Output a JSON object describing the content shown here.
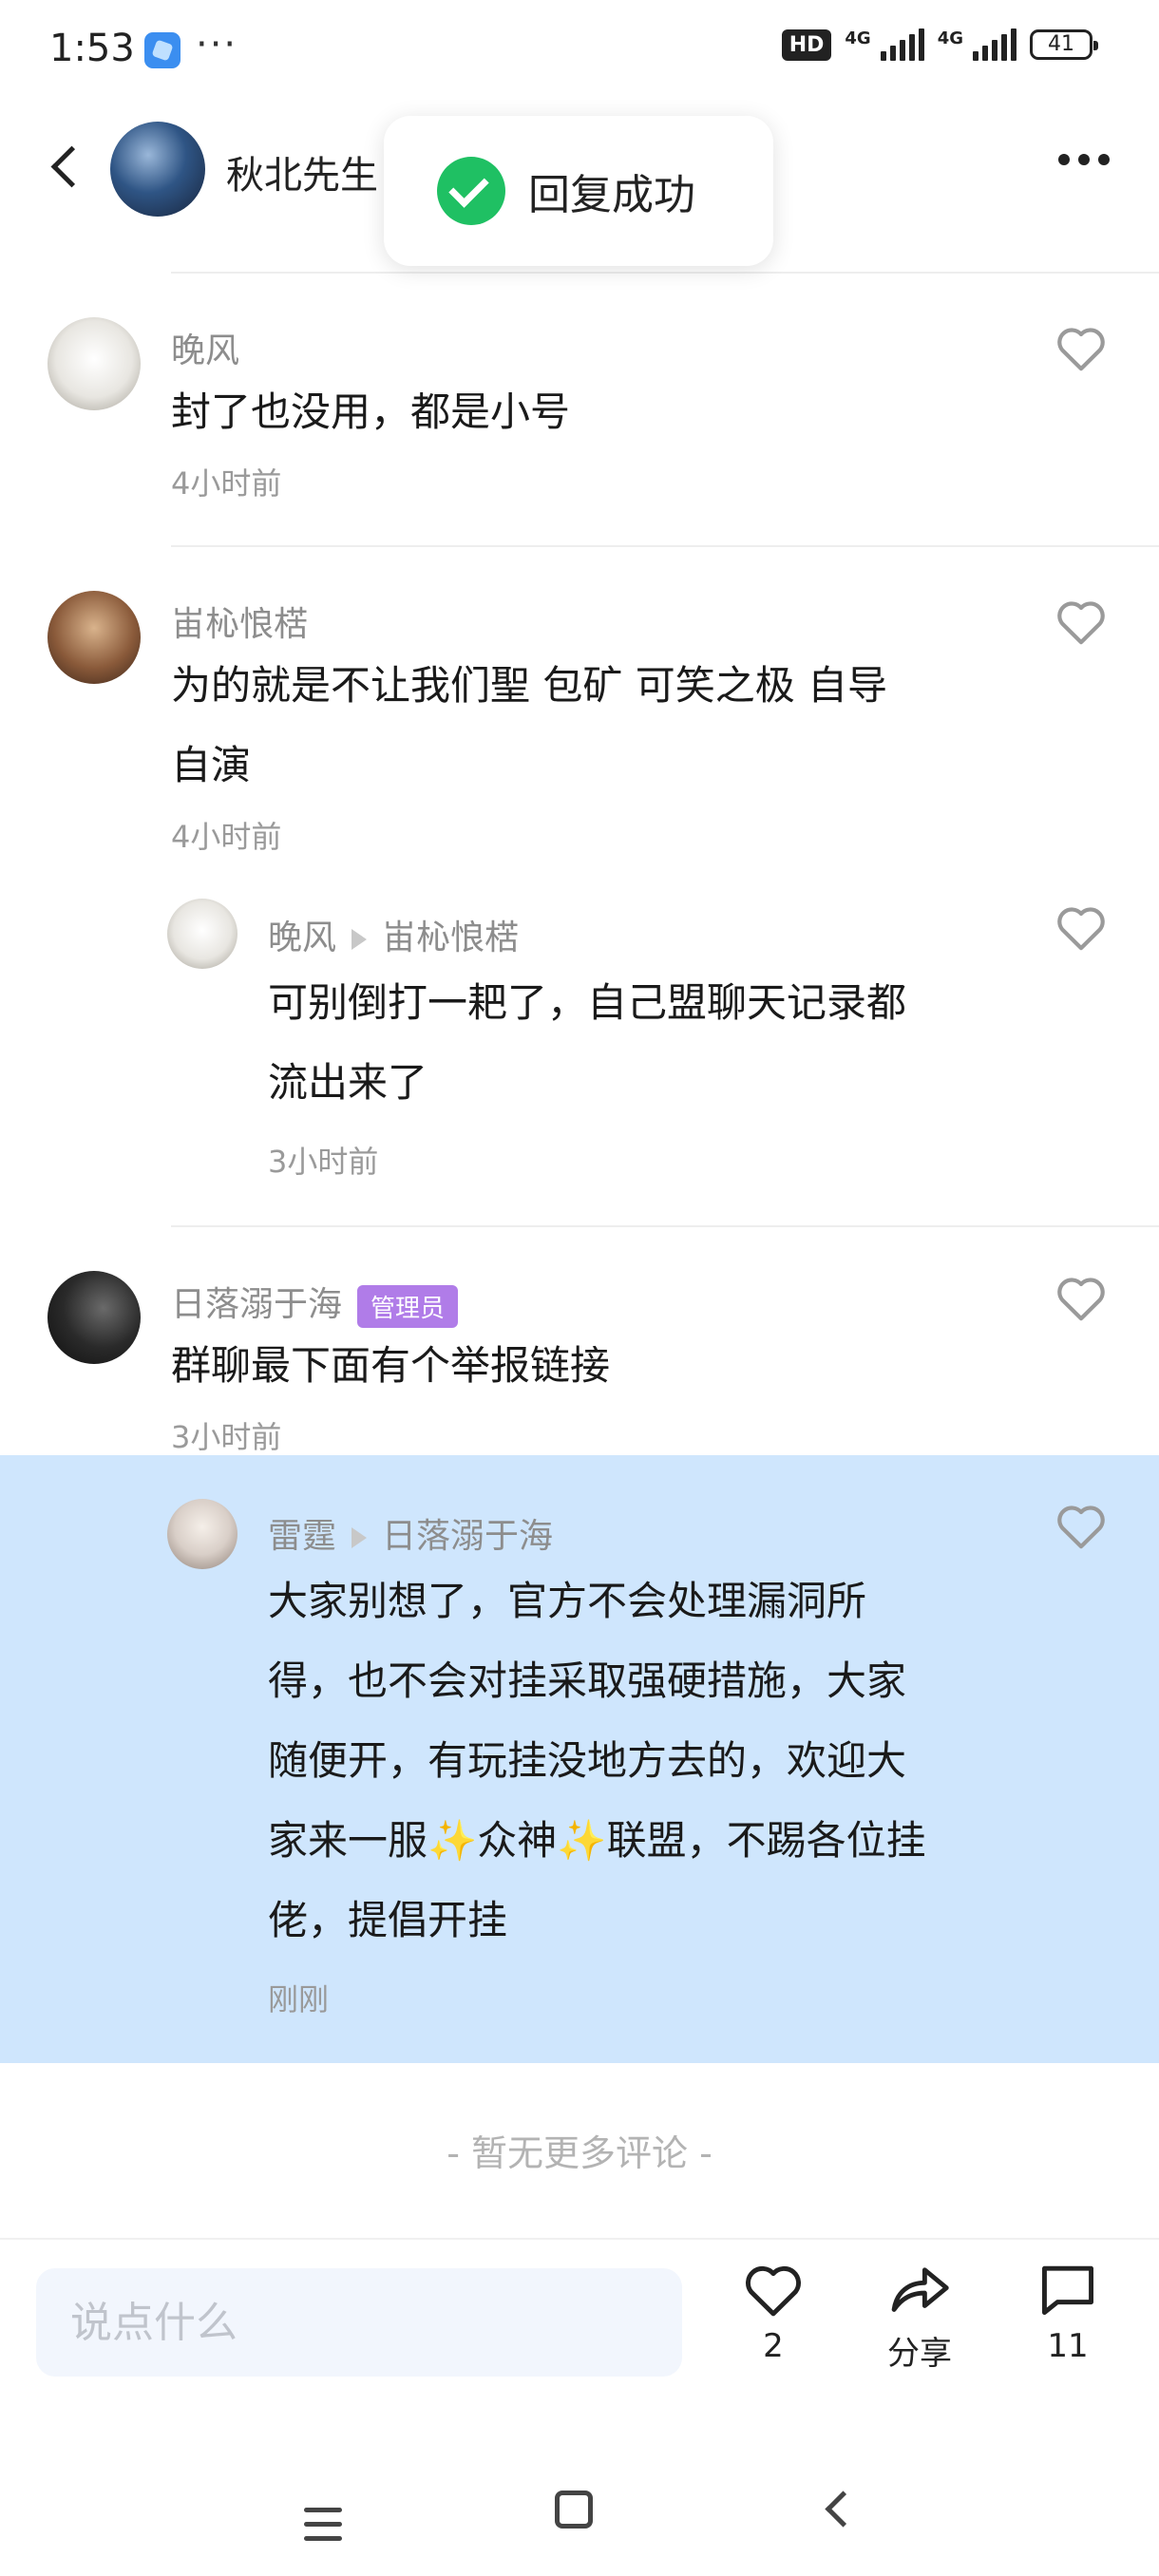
{
  "status_bar": {
    "time": "1:53",
    "more": "···",
    "hd": "HD",
    "network_1": "4G",
    "network_2": "4G",
    "battery": "41"
  },
  "header": {
    "author_name": "秋北先生"
  },
  "toast": {
    "message": "回复成功"
  },
  "comments": [
    {
      "user": "晚风",
      "content": "封了也没用，都是小号",
      "time": "4小时前",
      "avatar_color": "#e8e6e1"
    },
    {
      "user": "峀杺悢楛",
      "content_line1": "为的就是不让我们聖 包矿 可笑之极 自导",
      "content_line2": "自演",
      "time": "4小时前",
      "avatar_color": "#8a5a3a"
    },
    {
      "reply_from": "晚风",
      "reply_to": "峀杺悢楛",
      "content_line1": "可别倒打一耙了，自己盟聊天记录都",
      "content_line2": "流出来了",
      "time": "3小时前",
      "avatar_color": "#e8e6e1"
    },
    {
      "user": "日落溺于海",
      "badge": "管理员",
      "content": "群聊最下面有个举报链接",
      "time": "3小时前",
      "avatar_color": "#2a2a2a",
      "badge_color": "#b07ce8"
    },
    {
      "reply_from": "雷霆",
      "reply_to": "日落溺于海",
      "content_lines": [
        "大家别想了，官方不会处理漏洞所",
        "得，也不会对挂采取强硬措施，大家",
        "随便开，有玩挂没地方去的，欢迎大",
        "家来一服✨众神✨联盟，不踢各位挂",
        "佬，提倡开挂"
      ],
      "time": "刚刚",
      "avatar_color": "#d9cfc8",
      "highlight_color": "#cfe6fd"
    }
  ],
  "no_more": "- 暂无更多评论 -",
  "bottom_bar": {
    "input_placeholder": "说点什么",
    "like_count": "2",
    "share_label": "分享",
    "comment_count": "11"
  }
}
